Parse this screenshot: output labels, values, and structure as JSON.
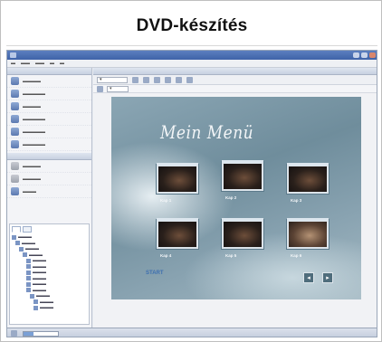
{
  "caption": "DVD-készítés",
  "app": {
    "title": "",
    "menu": []
  },
  "left_pane": {
    "tasks_header": "",
    "tasks": [
      {
        "icon": "add-video-icon"
      },
      {
        "icon": "import-icon"
      },
      {
        "icon": "menu-icon"
      },
      {
        "icon": "edit-menu-icon"
      },
      {
        "icon": "chapter-icon"
      },
      {
        "icon": "burn-icon"
      }
    ],
    "nav_header": "",
    "nav_items": [
      {
        "icon": "back-icon"
      },
      {
        "icon": "forward-icon"
      },
      {
        "icon": "preview-icon"
      }
    ],
    "tree_tabs": [
      "",
      ""
    ],
    "tree_item_count": 13
  },
  "main": {
    "header": "",
    "dvd_menu": {
      "title": "Mein Menü",
      "thumbnails": [
        {
          "label": "Kap 1"
        },
        {
          "label": "Kap 2"
        },
        {
          "label": "Kap 3"
        },
        {
          "label": "Kap 4"
        },
        {
          "label": "Kap 5"
        },
        {
          "label": "Kap 6"
        }
      ],
      "start_label": "START",
      "prev_icon": "chevron-left-icon",
      "next_icon": "chevron-right-icon"
    }
  },
  "status": {
    "progress": 0.3
  },
  "colors": {
    "titlebar": "#3f63a8",
    "menu_background": "#7d97a5",
    "accent": "#3d6fb0"
  }
}
